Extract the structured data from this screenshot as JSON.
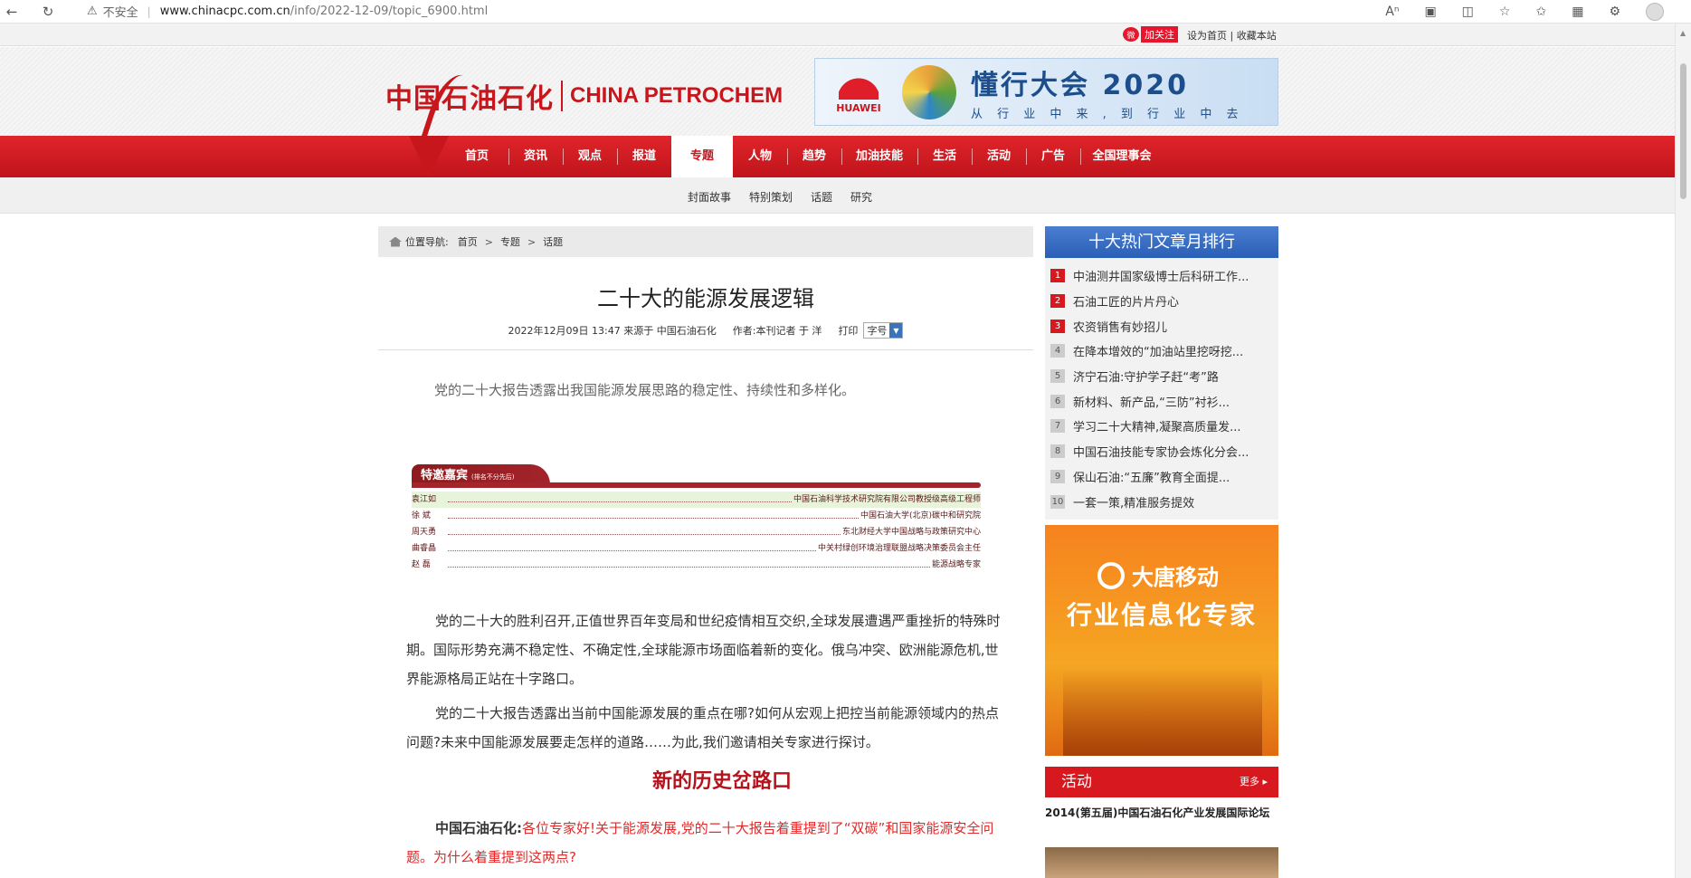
{
  "browser": {
    "security_label": "不安全",
    "url_host": "www.chinacpc.com.cn",
    "url_path": "/info/2022-12-09/topic_6900.html"
  },
  "topbar": {
    "follow_label": "加关注",
    "links": "设为首页 | 收藏本站"
  },
  "header": {
    "logo_cn": "中国石油石化",
    "logo_en": "CHINA PETROCHEM",
    "banner_brand": "HUAWEI",
    "banner_title": "懂行大会 2020",
    "banner_sub": "从 行 业 中 来 , 到 行 业 中 去"
  },
  "nav": {
    "items": [
      "首页",
      "资讯",
      "观点",
      "报道",
      "专题",
      "人物",
      "趋势",
      "加油技能",
      "生活",
      "活动",
      "广告",
      "全国理事会"
    ],
    "active": "专题",
    "sub": [
      "封面故事",
      "特别策划",
      "话题",
      "研究"
    ]
  },
  "breadcrumb": {
    "label": "位置导航:",
    "items": [
      "首页",
      "专题",
      "话题"
    ]
  },
  "article": {
    "title": "二十大的能源发展逻辑",
    "meta_date": "2022年12月09日 13:47",
    "meta_source": "来源于 中国石油石化",
    "meta_author": "作者:本刊记者 于 洋",
    "print": "打印",
    "font_label": "字号",
    "lead": "党的二十大报告透露出我国能源发展思路的稳定性、持续性和多样化。",
    "guests_title": "特邀嘉宾",
    "guests_note": "(排名不分先后)",
    "guests": [
      {
        "name": "袁江如",
        "org": "中国石油科学技术研究院有限公司教授级高级工程师"
      },
      {
        "name": "徐 斌",
        "org": "中国石油大学(北京)碳中和研究院"
      },
      {
        "name": "周天勇",
        "org": "东北财经大学中国战略与政策研究中心"
      },
      {
        "name": "曲睿晶",
        "org": "中关村绿创环境治理联盟战略决策委员会主任"
      },
      {
        "name": "赵 磊",
        "org": "能源战略专家"
      }
    ],
    "para1": "党的二十大的胜利召开,正值世界百年变局和世纪疫情相互交织,全球发展遭遇严重挫折的特殊时期。国际形势充满不稳定性、不确定性,全球能源市场面临着新的变化。俄乌冲突、欧洲能源危机,世界能源格局正站在十字路口。",
    "para2": "党的二十大报告透露出当前中国能源发展的重点在哪?如何从宏观上把控当前能源领域内的热点问题?未来中国能源发展要走怎样的道路……为此,我们邀请相关专家进行探讨。",
    "section_title": "新的历史岔路口",
    "qa_speaker": "中国石油石化:",
    "qa_text": "各位专家好!关于能源发展,党的二十大报告着重提到了“双碳”和国家能源安全问题。为什么着重提到这两点?"
  },
  "sidebar": {
    "hot_title": "十大热门文章月排行",
    "hot_items": [
      "中油测井国家级博士后科研工作...",
      "石油工匠的片片丹心",
      "农资销售有妙招儿",
      "在降本增效的“加油站里挖呀挖...",
      "济宁石油:守护学子赶“考”路",
      "新材料、新产品,“三防”衬衫...",
      "学习二十大精神,凝聚高质量发...",
      "中国石油技能专家协会炼化分会...",
      "保山石油:“五廉”教育全面提...",
      "一套一策,精准服务提效"
    ],
    "ad_brand": "大唐移动",
    "ad_slogan": "行业信息化专家",
    "activity_title": "活动",
    "activity_more": "更多",
    "activity_item": "2014(第五届)中国石油石化产业发展国际论坛"
  }
}
